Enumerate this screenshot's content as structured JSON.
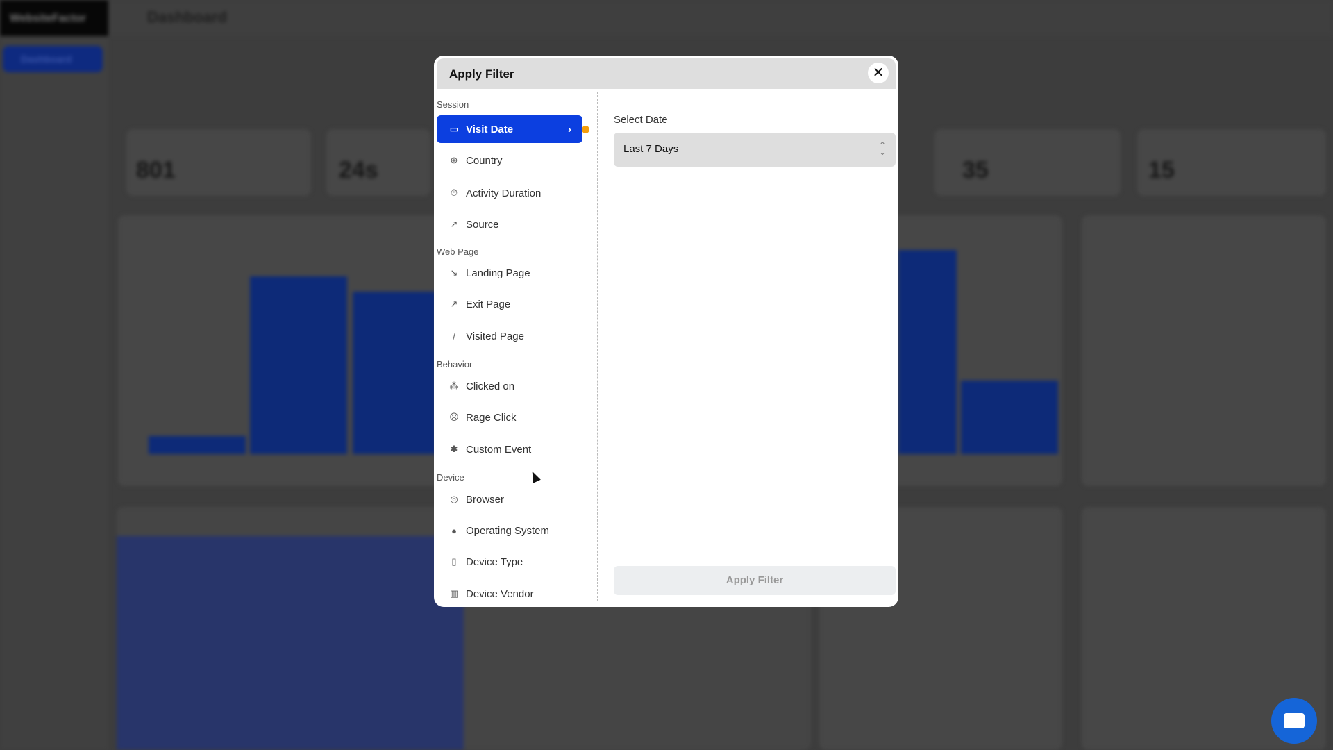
{
  "background": {
    "brand": "WebsiteFactor",
    "page_title": "Dashboard",
    "sidebar_active": "Dashboard",
    "stats": [
      "801",
      "24s",
      "35",
      "15"
    ]
  },
  "modal": {
    "title": "Apply Filter",
    "close_icon": "close-icon",
    "sections": [
      {
        "label": "Session",
        "items": [
          {
            "label": "Visit Date",
            "icon": "calendar-icon",
            "selected": true
          },
          {
            "label": "Country",
            "icon": "globe-icon"
          },
          {
            "label": "Activity Duration",
            "icon": "stopwatch-icon"
          },
          {
            "label": "Source",
            "icon": "source-icon"
          }
        ]
      },
      {
        "label": "Web Page",
        "items": [
          {
            "label": "Landing Page",
            "icon": "arrow-down-right-icon"
          },
          {
            "label": "Exit Page",
            "icon": "arrow-up-right-icon"
          },
          {
            "label": "Visited Page",
            "icon": "slash-icon"
          }
        ]
      },
      {
        "label": "Behavior",
        "items": [
          {
            "label": "Clicked on",
            "icon": "click-icon"
          },
          {
            "label": "Rage Click",
            "icon": "angry-face-icon"
          },
          {
            "label": "Custom Event",
            "icon": "asterisk-icon"
          }
        ]
      },
      {
        "label": "Device",
        "items": [
          {
            "label": "Browser",
            "icon": "chrome-icon"
          },
          {
            "label": "Operating System",
            "icon": "apple-icon"
          },
          {
            "label": "Device Type",
            "icon": "phone-icon"
          },
          {
            "label": "Device Vendor",
            "icon": "building-icon"
          }
        ]
      }
    ],
    "select_label": "Select Date",
    "select_value": "Last 7 Days",
    "apply_label": "Apply Filter"
  },
  "colors": {
    "accent": "#0c3fe0",
    "indicator": "#f59e0b",
    "chat": "#1565d8"
  }
}
